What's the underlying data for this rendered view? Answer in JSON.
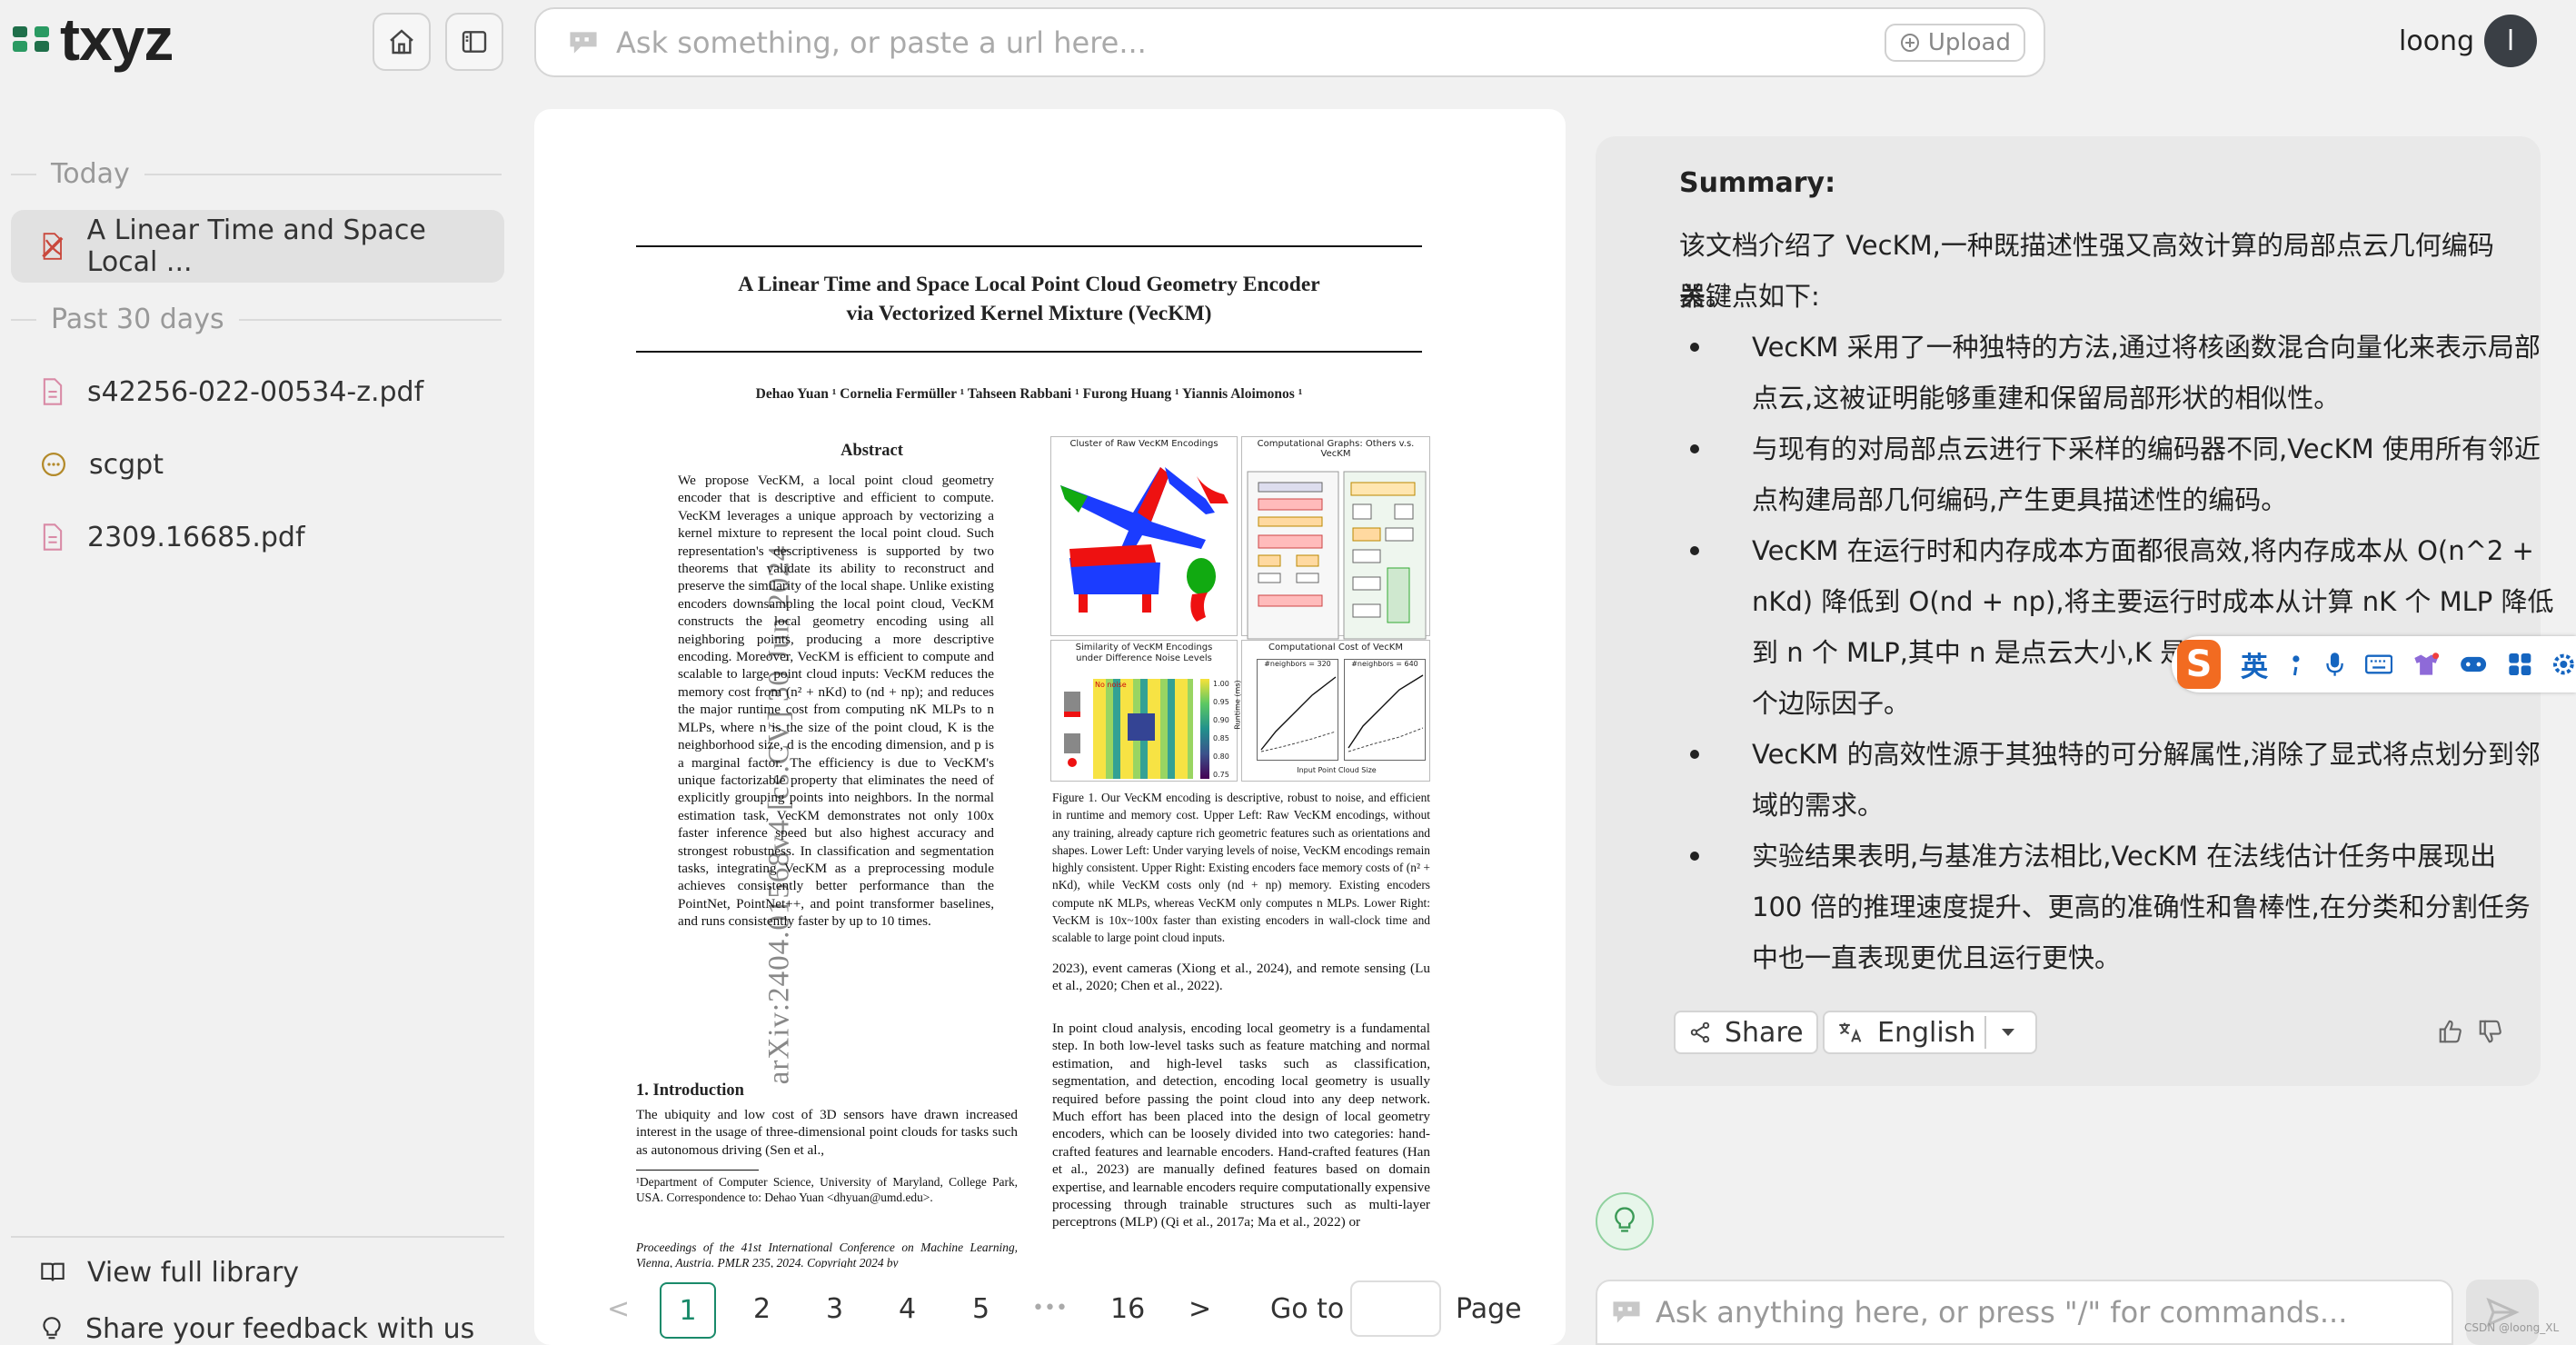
{
  "app": {
    "logo_text": "txyz",
    "user_name": "loong",
    "avatar_letter": "l"
  },
  "search": {
    "placeholder": "Ask something, or paste a url here...",
    "upload_label": "Upload"
  },
  "sidebar": {
    "sections": [
      {
        "title": "Today",
        "items": [
          {
            "label": "A Linear Time and Space Local ...",
            "icon": "pdf-icon-red",
            "active": true
          }
        ]
      },
      {
        "title": "Past 30 days",
        "items": [
          {
            "label": "s42256-022-00534-z.pdf",
            "icon": "pdf-file-icon"
          },
          {
            "label": "scgpt",
            "icon": "chat-bubble-icon"
          },
          {
            "label": "2309.16685.pdf",
            "icon": "pdf-file-icon"
          }
        ]
      }
    ],
    "bottom": [
      {
        "label": "View full library",
        "icon": "book-icon"
      },
      {
        "label": "Share your feedback with us",
        "icon": "lightbulb-icon"
      }
    ]
  },
  "paper": {
    "title_line1": "A Linear Time and Space Local Point Cloud Geometry Encoder",
    "title_line2": "via Vectorized Kernel Mixture (VecKM)",
    "authors": "Dehao Yuan ¹  Cornelia Fermüller ¹  Tahseen Rabbani ¹  Furong Huang ¹  Yiannis Aloimonos ¹",
    "arxiv_stamp": "arXiv:2404.01568v4  [cs.CV]  30 Jun 2024",
    "abstract_heading": "Abstract",
    "abstract_text": "We propose VecKM, a local point cloud geometry encoder that is descriptive and efficient to compute. VecKM leverages a unique approach by vectorizing a kernel mixture to represent the local point cloud. Such representation's descriptiveness is supported by two theorems that validate its ability to reconstruct and preserve the similarity of the local shape. Unlike existing encoders downsampling the local point cloud, VecKM constructs the local geometry encoding using all neighboring points, producing a more descriptive encoding. Moreover, VecKM is efficient to compute and scalable to large point cloud inputs: VecKM reduces the memory cost from (n² + nKd) to (nd + np); and reduces the major runtime cost from computing nK MLPs to n MLPs, where n is the size of the point cloud, K is the neighborhood size, d is the encoding dimension, and p is a marginal factor. The efficiency is due to VecKM's unique factorizable property that eliminates the need of explicitly grouping points into neighbors. In the normal estimation task, VecKM demonstrates not only 100x faster inference speed but also highest accuracy and strongest robustness. In classification and segmentation tasks, integrating VecKM as a preprocessing module achieves consistently better performance than the PointNet, PointNet++, and point transformer baselines, and runs consistently faster by up to 10 times.",
    "intro_heading": "1. Introduction",
    "intro_text": "The ubiquity and low cost of 3D sensors have drawn increased interest in the usage of three-dimensional point clouds for tasks such as autonomous driving (Sen et al.,",
    "footnote1": "¹Department of Computer Science, University of Maryland, College Park, USA. Correspondence to: Dehao Yuan <dhyuan@umd.edu>.",
    "footnote2": "Proceedings of the 41st International Conference on Machine Learning, Vienna, Austria. PMLR 235, 2024. Copyright 2024 by",
    "fig_label_1": "Cluster of Raw VecKM Encodings",
    "fig_label_2": "Computational Graphs: Others v.s. VecKM",
    "fig_label_3": "Similarity of VecKM Encodings under Difference Noise Levels",
    "fig_label_4": "Computational Cost of VecKM",
    "fig_noise_label": "No noise",
    "fig_subplot_1": "#neighbors = 320",
    "fig_subplot_2": "#neighbors = 640",
    "fig_xlabel": "Input Point Cloud Size",
    "fig_ylabel": "Runtime (ms)",
    "colorbar_ticks": [
      "1.00",
      "0.95",
      "0.90",
      "0.85",
      "0.80",
      "0.75"
    ],
    "caption": "Figure 1. Our VecKM encoding is descriptive, robust to noise, and efficient in runtime and memory cost. Upper Left: Raw VecKM encodings, without any training, already capture rich geometric features such as orientations and shapes. Lower Left: Under varying levels of noise, VecKM encodings remain highly consistent. Upper Right: Existing encoders face memory costs of (n² + nKd), while VecKM costs only (nd + np) memory. Existing encoders compute nK MLPs, whereas VecKM only computes n MLPs. Lower Right: VecKM is 10x~100x faster than existing encoders in wall-clock time and scalable to large point cloud inputs.",
    "right_para1": "2023), event cameras (Xiong et al., 2024), and remote sensing (Lu et al., 2020; Chen et al., 2022).",
    "right_para2": "In point cloud analysis, encoding local geometry is a fundamental step. In both low-level tasks such as feature matching and normal estimation, and high-level tasks such as classification, segmentation, and detection, encoding local geometry is usually required before passing the point cloud into any deep network. Much effort has been placed into the design of local geometry encoders, which can be loosely divided into two categories: hand-crafted features and learnable encoders. Hand-crafted features (Han et al., 2023) are manually defined features based on domain expertise, and learnable encoders require computationally expensive processing through trainable structures such as multi-layer perceptrons (MLP) (Qi et al., 2017a; Ma et al., 2022) or"
  },
  "pager": {
    "prev": "<",
    "pages": [
      "1",
      "2",
      "3",
      "4",
      "5"
    ],
    "current": "1",
    "ellipsis": "•••",
    "last": "16",
    "next": ">",
    "goto_label": "Go to",
    "page_label": "Page"
  },
  "summary": {
    "title": "Summary:",
    "intro": "该文档介绍了 VecKM,一种既描述性强又高效计算的局部点云几何编码器。",
    "lead": "关键点如下:",
    "bullets": [
      [
        "VecKM 采用了一种独特的方法,通过将核函数混合向量化来表示局部",
        "点云,这被证明能够重建和保留局部形状的相似性。"
      ],
      [
        "与现有的对局部点云进行下采样的编码器不同,VecKM 使用所有邻近",
        "点构建局部几何编码,产生更具描述性的编码。"
      ],
      [
        "VecKM 在运行时和内存成本方面都很高效,将内存成本从 O(n^2 +",
        "nKd) 降低到 O(nd + np),将主要运行时成本从计算 nK 个 MLP 降低",
        "到 n 个 MLP,其中 n 是点云大小,K 是邻",
        "个边际因子。"
      ],
      [
        "VecKM 的高效性源于其独特的可分解属性,消除了显式将点划分到邻",
        "域的需求。"
      ],
      [
        "实验结果表明,与基准方法相比,VecKM 在法线估计任务中展现出",
        "100 倍的推理速度提升、更高的准确性和鲁棒性,在分类和分割任务",
        "中也一直表现更优且运行更快。"
      ]
    ],
    "share_label": "Share",
    "language_label": "English"
  },
  "ime": {
    "lang_char": "英",
    "logo_char": "S"
  },
  "ask": {
    "placeholder": "Ask anything here, or press \"/\" for commands..."
  },
  "watermark": "CSDN @loong_XL",
  "colors": {
    "accent": "#1a8a6a",
    "bg": "#f1f1f1",
    "panel": "#e9e9e9",
    "ime_orange": "#f26b21"
  }
}
